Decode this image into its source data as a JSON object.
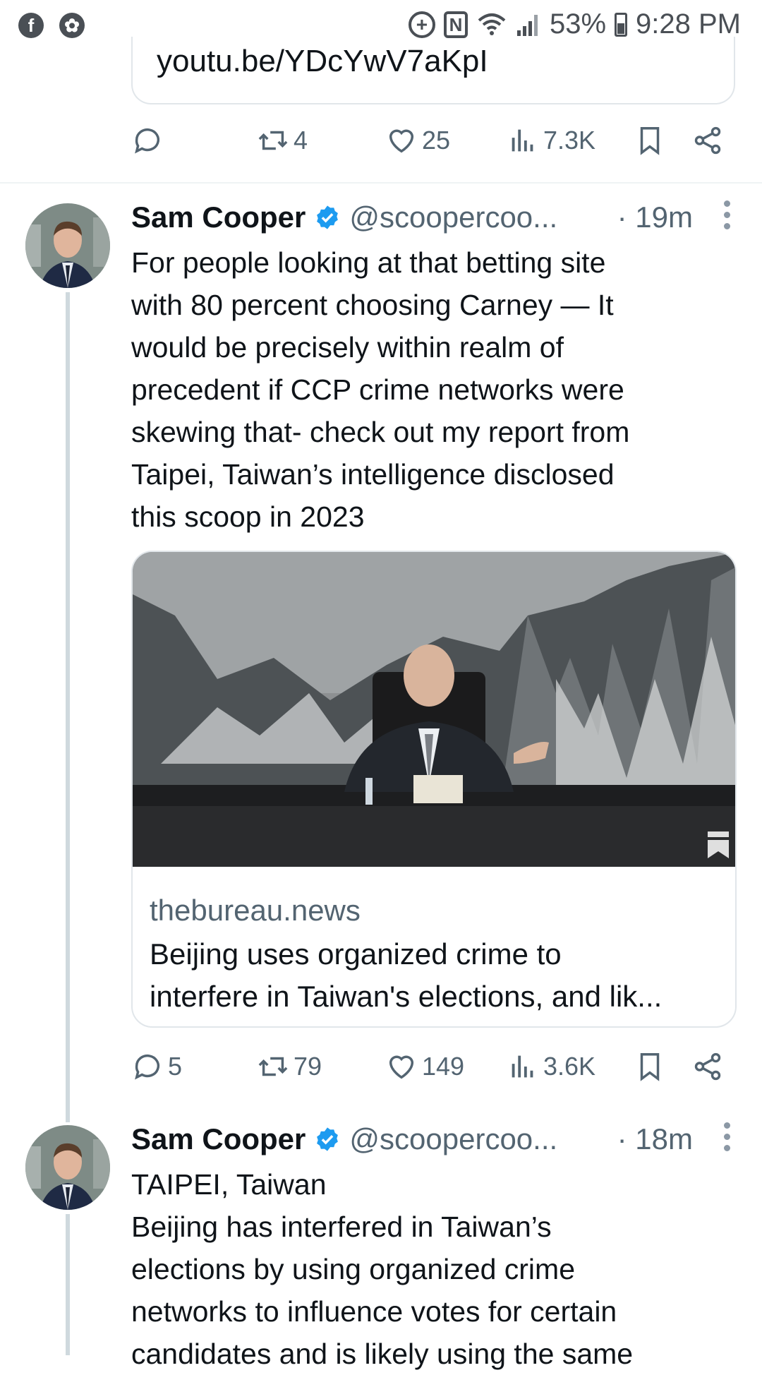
{
  "status_bar": {
    "battery_percent": "53%",
    "time": "9:28 PM",
    "left_icons": [
      "facebook-icon",
      "flower-icon"
    ],
    "right_icons": [
      "add-circle-icon",
      "nfc-icon",
      "wifi-icon",
      "signal-icon",
      "battery-icon"
    ]
  },
  "previous_tweet": {
    "link_text": "youtu.be/YDcYwV7aKpI",
    "actions": {
      "replies": "",
      "retweets": "4",
      "likes": "25",
      "views": "7.3K"
    }
  },
  "tweets": [
    {
      "name": "Sam Cooper",
      "handle": "@scoopercoo...",
      "time": "· 19m",
      "text": "For people looking at that betting site\nwith 80 percent choosing Carney — It\nwould be precisely within realm of\nprecedent if CCP crime networks were\nskewing that- check out my report from\nTaipei, Taiwan’s intelligence disclosed\nthis scoop in 2023",
      "card": {
        "domain": "thebureau.news",
        "title": "Beijing uses organized crime to\ninterfere in Taiwan's elections, and lik..."
      },
      "actions": {
        "replies": "5",
        "retweets": "79",
        "likes": "149",
        "views": "3.6K"
      }
    },
    {
      "name": "Sam Cooper",
      "handle": "@scoopercoo...",
      "time": "· 18m",
      "text": "TAIPEI, Taiwan\nBeijing has interfered in Taiwan’s\nelections by using organized crime\nnetworks to influence votes for certain\ncandidates and is likely using the same"
    }
  ],
  "colors": {
    "verified": "#1d9bf0",
    "muted": "#536471",
    "text": "#0f1419",
    "thread": "#cfd9de"
  }
}
